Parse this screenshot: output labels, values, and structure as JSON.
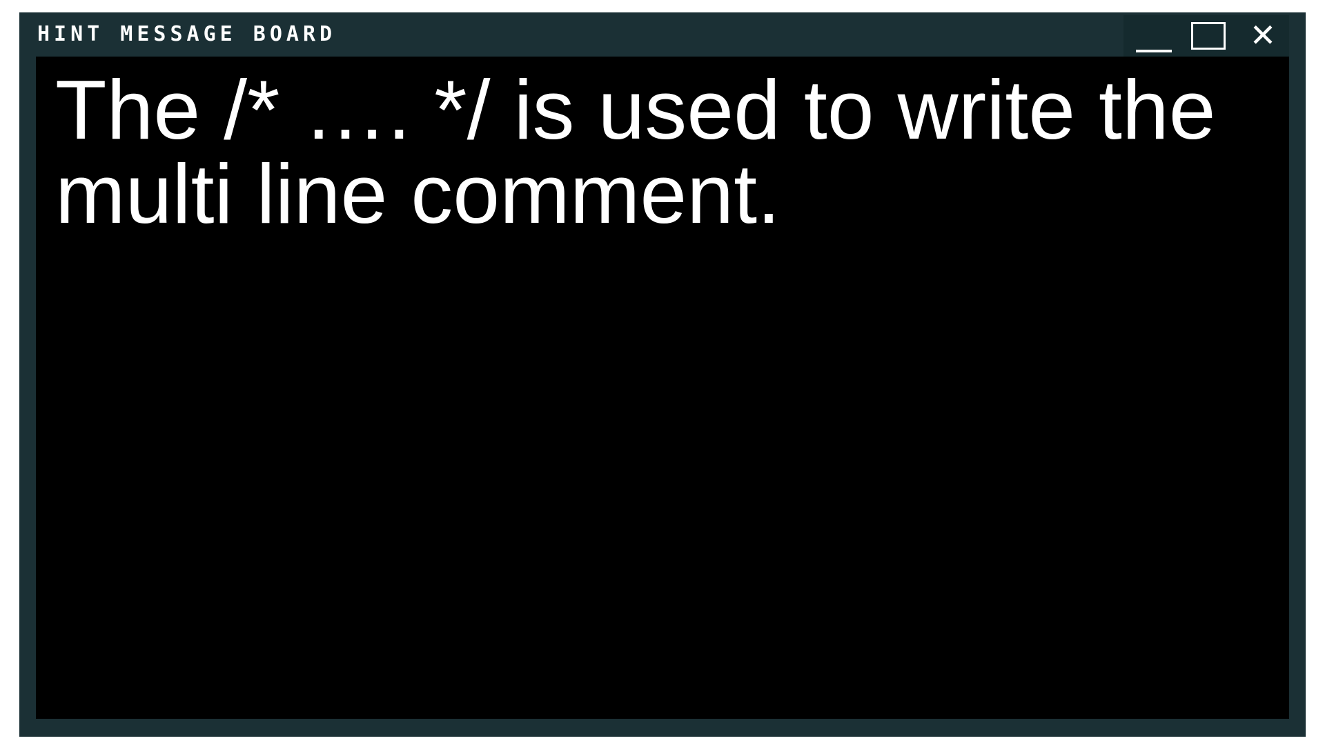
{
  "window": {
    "title": "HINT MESSAGE BOARD",
    "colors": {
      "frame": "#1b3035",
      "content_background": "#000000",
      "text": "#ffffff"
    }
  },
  "controls": {
    "minimize_icon": "minimize-icon",
    "maximize_icon": "maximize-icon",
    "close_icon": "close-icon",
    "close_glyph": "✕"
  },
  "content": {
    "message": "The /* …. */ is used to write the multi line comment."
  }
}
